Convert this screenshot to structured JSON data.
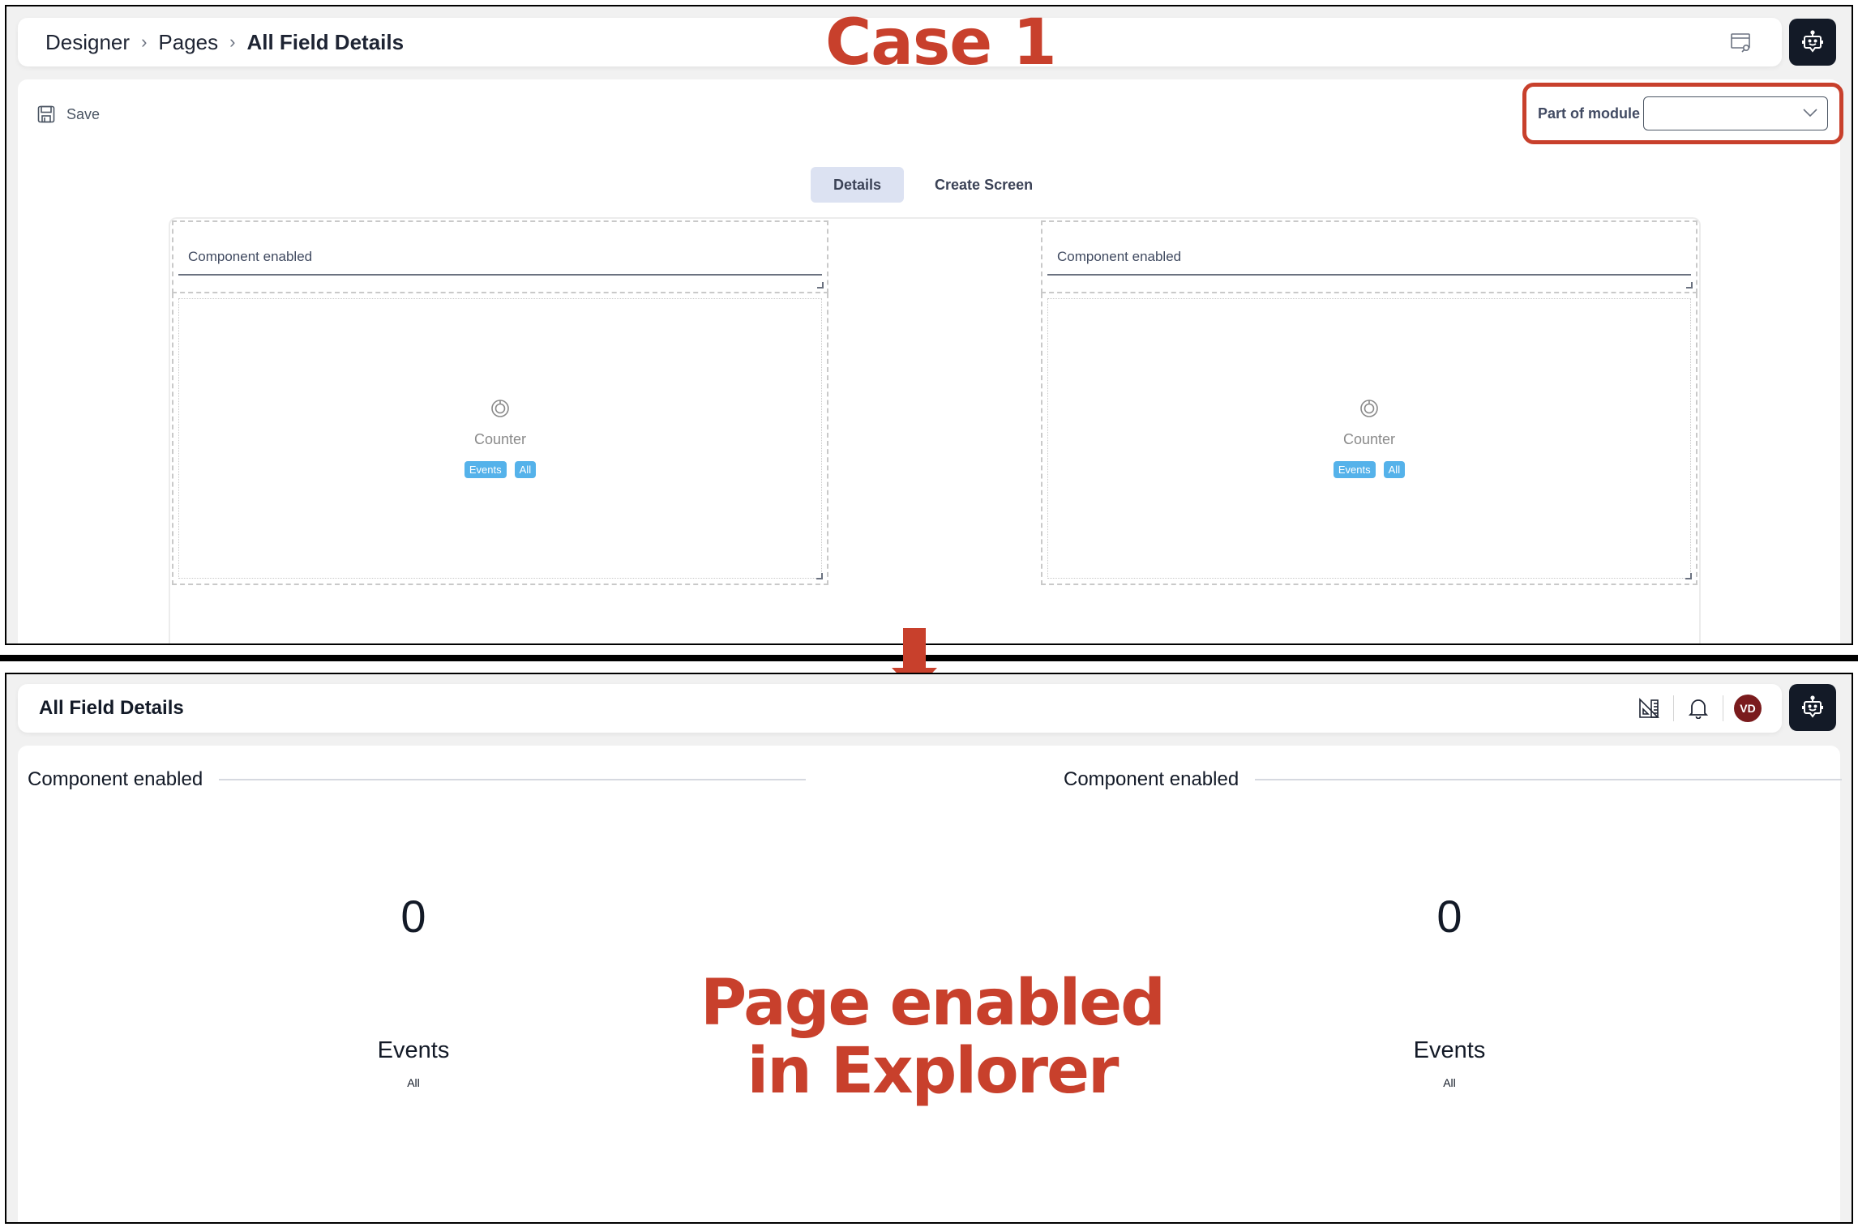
{
  "annotations": {
    "case_title": "Case 1",
    "explorer_note_line1": "Page enabled",
    "explorer_note_line2": "in Explorer",
    "accent_color": "#c8402c"
  },
  "designer": {
    "breadcrumb": [
      {
        "label": "Designer"
      },
      {
        "label": "Pages"
      },
      {
        "label": "All Field Details"
      }
    ],
    "header_icons": {
      "preview": "window-search-icon",
      "assistant": "robot-chat-icon"
    },
    "toolbar": {
      "save_label": "Save"
    },
    "module": {
      "label": "Part of module",
      "selected_value": "",
      "icon": "chevron-down-icon"
    },
    "tabs": [
      {
        "label": "Details",
        "active": true
      },
      {
        "label": "Create Screen",
        "active": false
      }
    ],
    "panels": [
      {
        "field_label": "Component enabled",
        "widget_icon": "counter-icon",
        "widget_label": "Counter",
        "tags": [
          "Events",
          "All"
        ]
      },
      {
        "field_label": "Component enabled",
        "widget_icon": "counter-icon",
        "widget_label": "Counter",
        "tags": [
          "Events",
          "All"
        ]
      }
    ],
    "tag_color": "#55b2ea"
  },
  "explorer": {
    "page_title": "All Field Details",
    "header_icons": [
      "ruler-triangle-icon",
      "bell-icon"
    ],
    "avatar_initials": "VD",
    "avatar_color": "#7a1b1d",
    "sections": [
      {
        "title": "Component enabled",
        "counter_value": "0",
        "counter_label": "Events",
        "counter_sub": "All"
      },
      {
        "title": "Component enabled",
        "counter_value": "0",
        "counter_label": "Events",
        "counter_sub": "All"
      }
    ]
  }
}
